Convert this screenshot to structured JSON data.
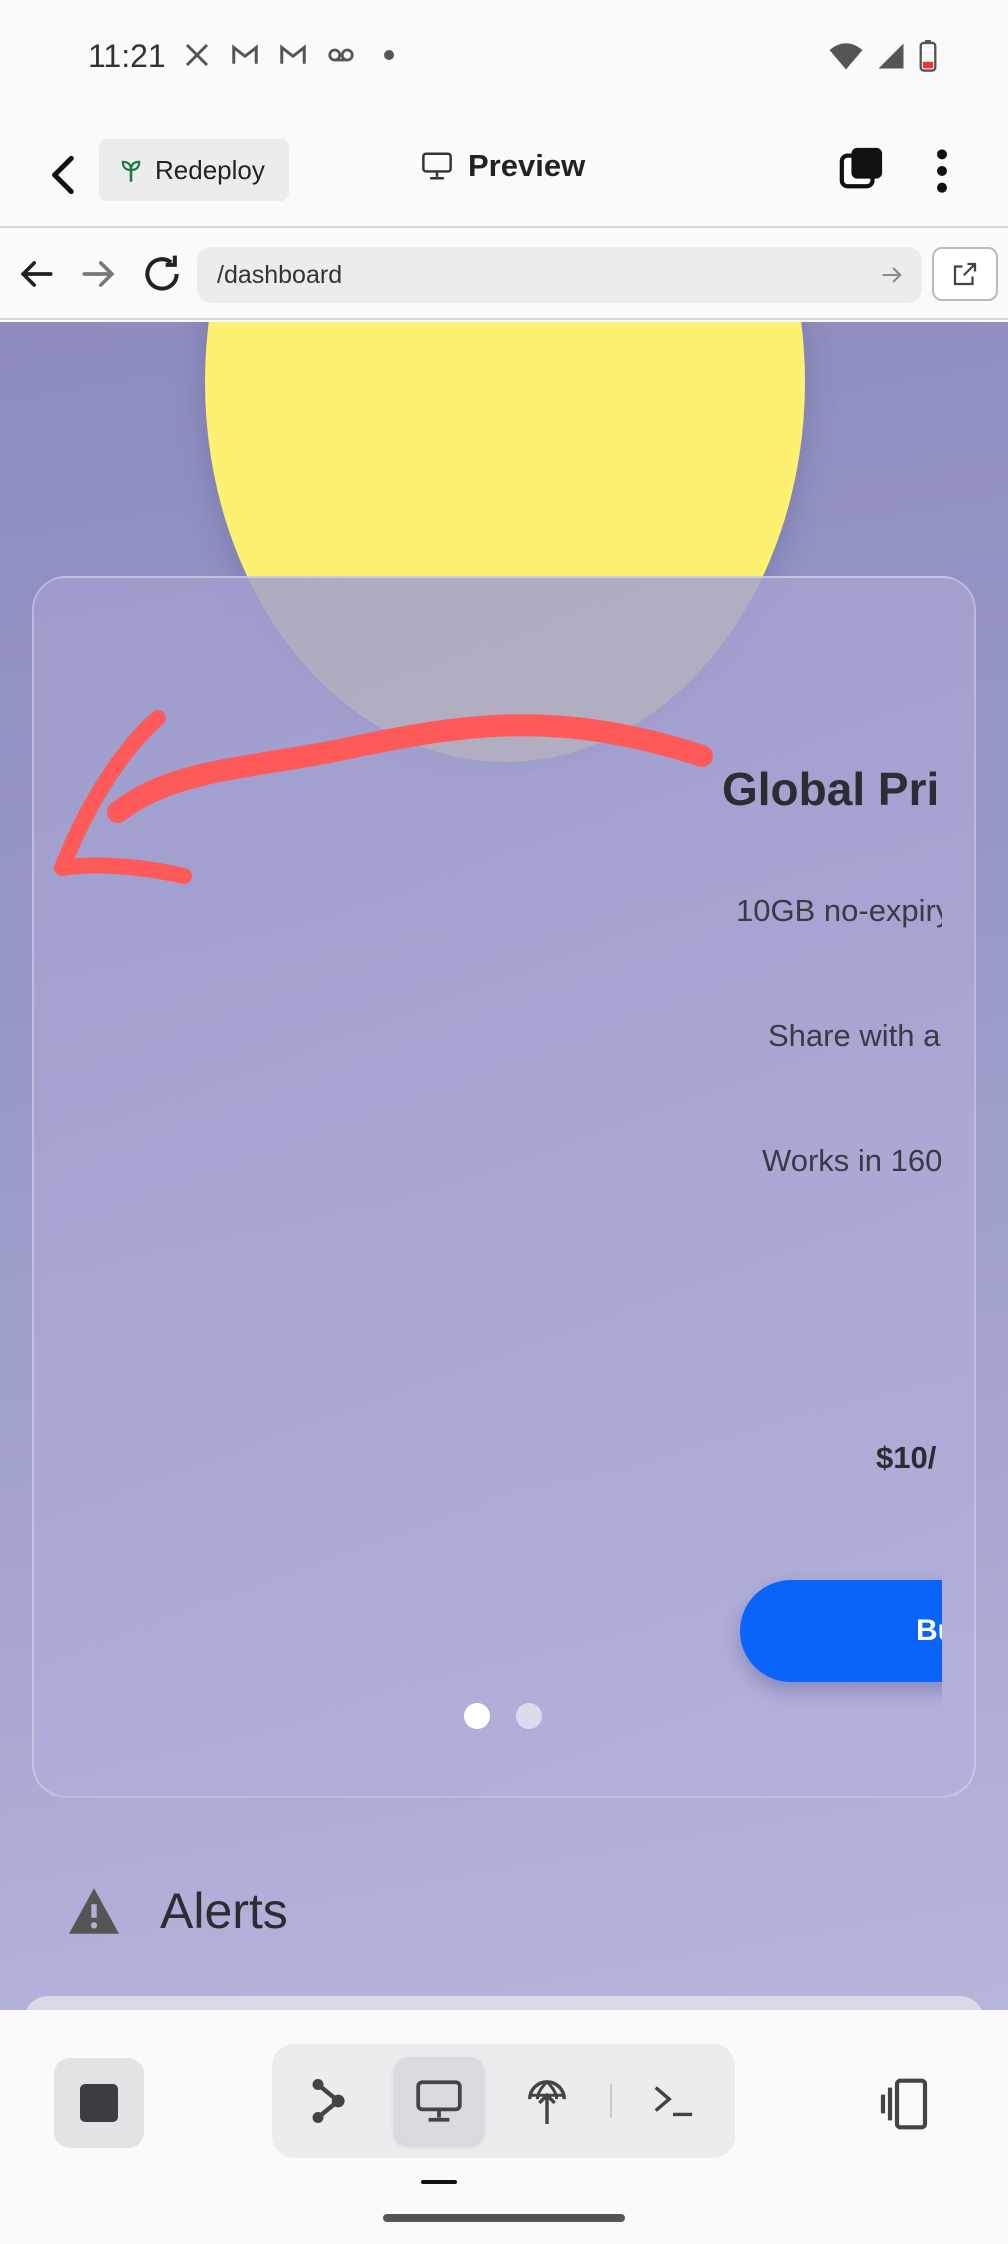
{
  "status_bar": {
    "time": "11:21",
    "notification_icons": [
      "x-icon",
      "gmail-icon",
      "gmail-icon",
      "voicemail-icon",
      "dot-icon"
    ],
    "system_icons": [
      "wifi-icon",
      "signal-icon",
      "battery-low-icon"
    ]
  },
  "app_bar": {
    "back_icon": "chevron-left-icon",
    "redeploy_label": "Redeploy",
    "title": "Preview",
    "title_icon": "monitor-icon"
  },
  "browser": {
    "url": "/dashboard"
  },
  "card": {
    "title": "Global Pri",
    "features": [
      "10GB no-expiry",
      "Share with a",
      "Works in 160"
    ],
    "price": "$10/",
    "buy_label": "Bu",
    "pagination": {
      "count": 2,
      "active_index": 0
    }
  },
  "alerts": {
    "title": "Alerts"
  },
  "annotation": {
    "color": "#ff5a5a",
    "shape": "hand-drawn arrow pointing left"
  },
  "colors": {
    "accent_blue": "#0a63fb",
    "sun_yellow": "#fef171",
    "background_purple": "#9696c6"
  }
}
